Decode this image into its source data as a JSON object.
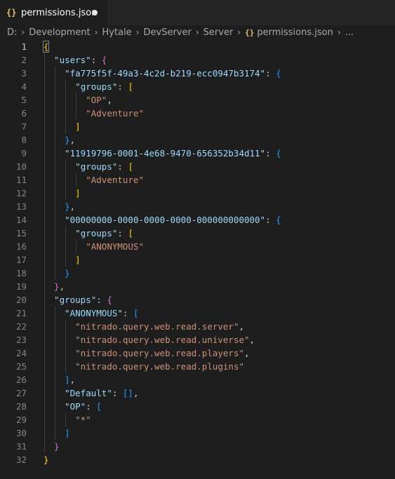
{
  "tab": {
    "icon": "{}",
    "filename": "permissions.json"
  },
  "breadcrumb": {
    "segments": [
      "D:",
      "Development",
      "Hytale",
      "DevServer",
      "Server"
    ],
    "file_icon": "{}",
    "file": "permissions.json",
    "ellipsis": "..."
  },
  "editor": {
    "active_line": 1,
    "lines": [
      {
        "n": "1",
        "indent": 0,
        "tokens": [
          [
            "b1",
            "{"
          ]
        ]
      },
      {
        "n": "2",
        "indent": 2,
        "tokens": [
          [
            "k",
            "\"users\""
          ],
          [
            "p",
            ": "
          ],
          [
            "b2",
            "{"
          ]
        ]
      },
      {
        "n": "3",
        "indent": 4,
        "tokens": [
          [
            "k",
            "\"fa775f5f-49a3-4c2d-b219-ecc0947b3174\""
          ],
          [
            "p",
            ": "
          ],
          [
            "b3",
            "{"
          ]
        ]
      },
      {
        "n": "4",
        "indent": 6,
        "tokens": [
          [
            "k",
            "\"groups\""
          ],
          [
            "p",
            ": "
          ],
          [
            "b1",
            "["
          ]
        ]
      },
      {
        "n": "5",
        "indent": 8,
        "tokens": [
          [
            "s",
            "\"OP\""
          ],
          [
            "p",
            ","
          ]
        ]
      },
      {
        "n": "6",
        "indent": 8,
        "tokens": [
          [
            "s",
            "\"Adventure\""
          ]
        ]
      },
      {
        "n": "7",
        "indent": 6,
        "tokens": [
          [
            "b1",
            "]"
          ]
        ]
      },
      {
        "n": "8",
        "indent": 4,
        "tokens": [
          [
            "b3",
            "}"
          ],
          [
            "p",
            ","
          ]
        ]
      },
      {
        "n": "9",
        "indent": 4,
        "tokens": [
          [
            "k",
            "\"11919796-0001-4e68-9470-656352b34d11\""
          ],
          [
            "p",
            ": "
          ],
          [
            "b3",
            "{"
          ]
        ]
      },
      {
        "n": "10",
        "indent": 6,
        "tokens": [
          [
            "k",
            "\"groups\""
          ],
          [
            "p",
            ": "
          ],
          [
            "b1",
            "["
          ]
        ]
      },
      {
        "n": "11",
        "indent": 8,
        "tokens": [
          [
            "s",
            "\"Adventure\""
          ]
        ]
      },
      {
        "n": "12",
        "indent": 6,
        "tokens": [
          [
            "b1",
            "]"
          ]
        ]
      },
      {
        "n": "13",
        "indent": 4,
        "tokens": [
          [
            "b3",
            "}"
          ],
          [
            "p",
            ","
          ]
        ]
      },
      {
        "n": "14",
        "indent": 4,
        "tokens": [
          [
            "k",
            "\"00000000-0000-0000-0000-000000000000\""
          ],
          [
            "p",
            ": "
          ],
          [
            "b3",
            "{"
          ]
        ]
      },
      {
        "n": "15",
        "indent": 6,
        "tokens": [
          [
            "k",
            "\"groups\""
          ],
          [
            "p",
            ": "
          ],
          [
            "b1",
            "["
          ]
        ]
      },
      {
        "n": "16",
        "indent": 8,
        "tokens": [
          [
            "s",
            "\"ANONYMOUS\""
          ]
        ]
      },
      {
        "n": "17",
        "indent": 6,
        "tokens": [
          [
            "b1",
            "]"
          ]
        ]
      },
      {
        "n": "18",
        "indent": 4,
        "tokens": [
          [
            "b3",
            "}"
          ]
        ]
      },
      {
        "n": "19",
        "indent": 2,
        "tokens": [
          [
            "b2",
            "}"
          ],
          [
            "p",
            ","
          ]
        ]
      },
      {
        "n": "20",
        "indent": 2,
        "tokens": [
          [
            "k",
            "\"groups\""
          ],
          [
            "p",
            ": "
          ],
          [
            "b2",
            "{"
          ]
        ]
      },
      {
        "n": "21",
        "indent": 4,
        "tokens": [
          [
            "k",
            "\"ANONYMOUS\""
          ],
          [
            "p",
            ": "
          ],
          [
            "b3",
            "["
          ]
        ]
      },
      {
        "n": "22",
        "indent": 6,
        "tokens": [
          [
            "s",
            "\"nitrado.query.web.read.server\""
          ],
          [
            "p",
            ","
          ]
        ]
      },
      {
        "n": "23",
        "indent": 6,
        "tokens": [
          [
            "s",
            "\"nitrado.query.web.read.universe\""
          ],
          [
            "p",
            ","
          ]
        ]
      },
      {
        "n": "24",
        "indent": 6,
        "tokens": [
          [
            "s",
            "\"nitrado.query.web.read.players\""
          ],
          [
            "p",
            ","
          ]
        ]
      },
      {
        "n": "25",
        "indent": 6,
        "tokens": [
          [
            "s",
            "\"nitrado.query.web.read.plugins\""
          ]
        ]
      },
      {
        "n": "26",
        "indent": 4,
        "tokens": [
          [
            "b3",
            "]"
          ],
          [
            "p",
            ","
          ]
        ]
      },
      {
        "n": "27",
        "indent": 4,
        "tokens": [
          [
            "k",
            "\"Default\""
          ],
          [
            "p",
            ": "
          ],
          [
            "b3",
            "[]"
          ],
          [
            "p",
            ","
          ]
        ]
      },
      {
        "n": "28",
        "indent": 4,
        "tokens": [
          [
            "k",
            "\"OP\""
          ],
          [
            "p",
            ": "
          ],
          [
            "b3",
            "["
          ]
        ]
      },
      {
        "n": "29",
        "indent": 6,
        "tokens": [
          [
            "s",
            "\"*\""
          ]
        ]
      },
      {
        "n": "30",
        "indent": 4,
        "tokens": [
          [
            "b3",
            "]"
          ]
        ]
      },
      {
        "n": "31",
        "indent": 2,
        "tokens": [
          [
            "b2",
            "}"
          ]
        ]
      },
      {
        "n": "32",
        "indent": 0,
        "tokens": [
          [
            "b1",
            "}"
          ]
        ]
      }
    ]
  },
  "colors": {
    "background": "#1e1e1e",
    "key": "#9cdcfe",
    "string": "#ce9178",
    "bracket_level1": "#ffd700",
    "bracket_level2": "#da70d6",
    "bracket_level3": "#179fff"
  }
}
